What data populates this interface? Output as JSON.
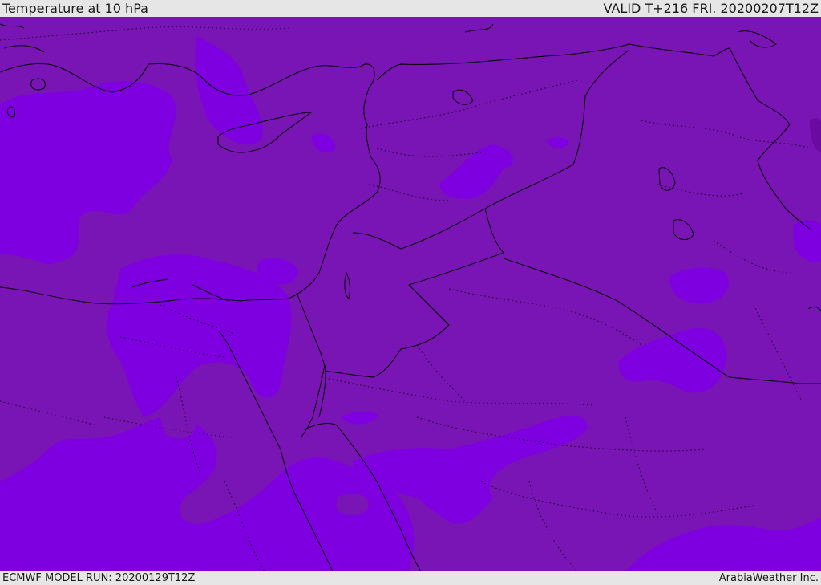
{
  "header": {
    "title": "Temperature at 10 hPa",
    "valid": "VALID T+216 FRI. 20200207T12Z"
  },
  "footer": {
    "model_run": "ECMWF MODEL RUN: 20200129T12Z",
    "credit": "ArabiaWeather Inc."
  },
  "map": {
    "field_colors": {
      "background": "#7a15b5",
      "warmer_band": "#7e00e0",
      "cold_spot": "#6a0aa0"
    },
    "line_colors": {
      "coastlines_and_borders": "#000000"
    }
  }
}
